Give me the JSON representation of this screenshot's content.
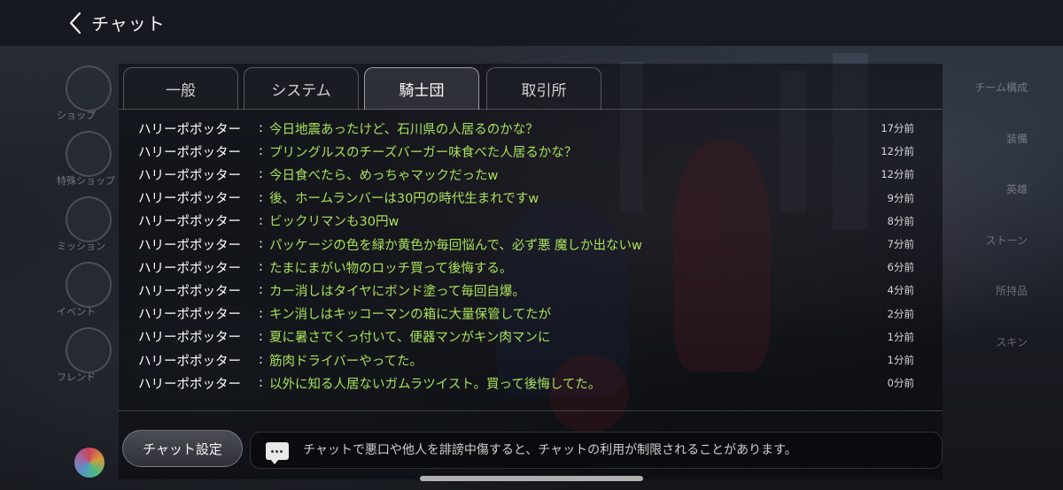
{
  "header": {
    "title": "チャット"
  },
  "tabs": [
    {
      "label": "一般",
      "active": false
    },
    {
      "label": "システム",
      "active": false
    },
    {
      "label": "騎士団",
      "active": true
    },
    {
      "label": "取引所",
      "active": false
    }
  ],
  "messages": [
    {
      "user": "ハリーポポッター",
      "sep": ":",
      "text": "今日地震あったけど、石川県の人居るのかな？",
      "time": "17分前"
    },
    {
      "user": "ハリーポポッター",
      "sep": ":",
      "text": "プリングルスのチーズバーガー味食べた人居るかな？",
      "time": "12分前"
    },
    {
      "user": "ハリーポポッター",
      "sep": ":",
      "text": "今日食べたら、めっちゃマックだったw",
      "time": "12分前"
    },
    {
      "user": "ハリーポポッター",
      "sep": ":",
      "text": "後、ホームランバーは30円の時代生まれですw",
      "time": "9分前"
    },
    {
      "user": "ハリーポポッター",
      "sep": ":",
      "text": "ビックリマンも30円w",
      "time": "8分前"
    },
    {
      "user": "ハリーポポッター",
      "sep": ":",
      "text": "パッケージの色を緑か黄色か毎回悩んで、必ず悪 魔しか出ないw",
      "time": "7分前"
    },
    {
      "user": "ハリーポポッター",
      "sep": ":",
      "text": "たまにまがい物のロッチ買って後悔する。",
      "time": "6分前"
    },
    {
      "user": "ハリーポポッター",
      "sep": ":",
      "text": "カー消しはタイヤにボンド塗って毎回自爆。",
      "time": "4分前"
    },
    {
      "user": "ハリーポポッター",
      "sep": ":",
      "text": "キン消しはキッコーマンの箱に大量保管してたが",
      "time": "2分前"
    },
    {
      "user": "ハリーポポッター",
      "sep": ":",
      "text": "夏に暑さでくっ付いて、便器マンがキン肉マンに",
      "time": "1分前"
    },
    {
      "user": "ハリーポポッター",
      "sep": ":",
      "text": "筋肉ドライバーやってた。",
      "time": "1分前"
    },
    {
      "user": "ハリーポポッター",
      "sep": ":",
      "text": "以外に知る人居ないガムラツイスト。買って後悔してた。",
      "time": "0分前"
    }
  ],
  "footer": {
    "settings_label": "チャット設定",
    "notice": "チャットで悪口や他人を誹謗中傷すると、チャットの利用が制限されることがあります。"
  },
  "background": {
    "left_menu": [
      "ショップ",
      "特殊ショップ",
      "ミッション",
      "イベント",
      "フレンド"
    ],
    "right_menu": [
      "チーム構成",
      "装備",
      "英雄",
      "ストーン",
      "所持品",
      "スキン"
    ]
  },
  "colors": {
    "message_text": "#a8e05a",
    "username": "#ffffff",
    "time": "#d8d8d8"
  },
  "icons": {
    "back": "chevron-left-icon",
    "notice": "chat-bubble-icon"
  }
}
